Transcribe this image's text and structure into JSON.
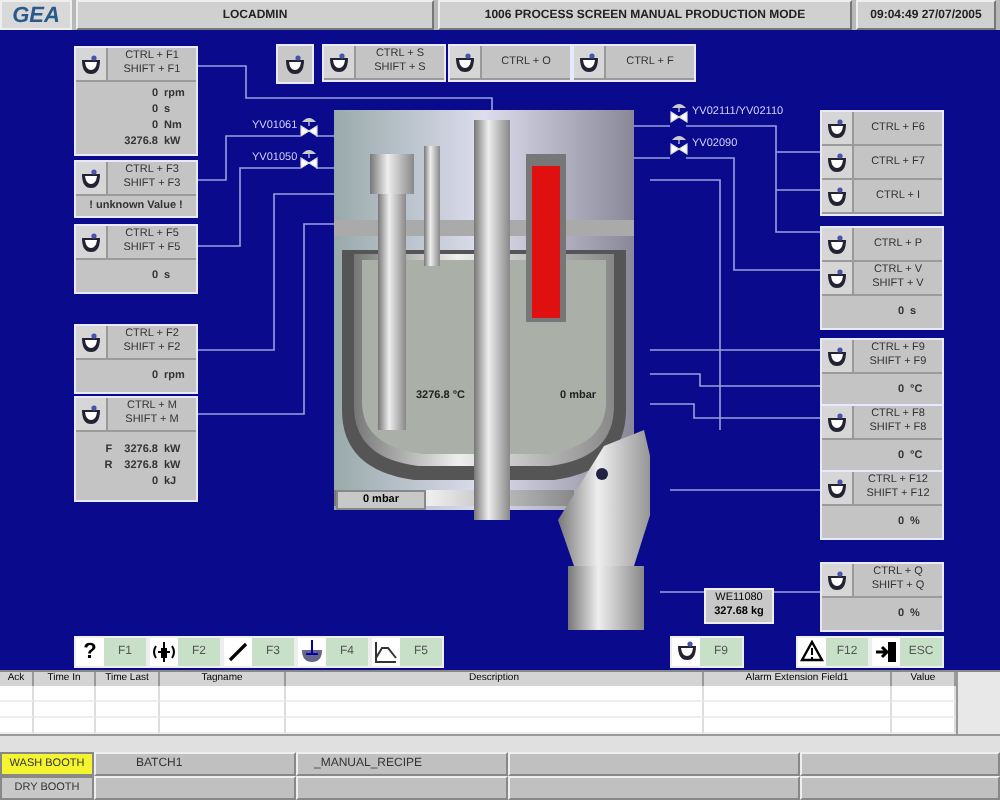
{
  "header": {
    "logo": "GEA",
    "user": "LOCADMIN",
    "title": "1006 PROCESS SCREEN MANUAL PRODUCTION  MODE",
    "datetime": "09:04:49  27/07/2005"
  },
  "left_panels": [
    {
      "keys": [
        "CTRL + F1",
        "SHIFT + F1"
      ],
      "readings": [
        {
          "value": "0",
          "unit": "rpm"
        },
        {
          "value": "0",
          "unit": "s"
        },
        {
          "value": "0",
          "unit": "Nm"
        },
        {
          "value": "3276.8",
          "unit": "kW"
        }
      ]
    },
    {
      "keys": [
        "CTRL + F3",
        "SHIFT + F3"
      ],
      "message": "! unknown Value !"
    },
    {
      "keys": [
        "CTRL + F5",
        "SHIFT + F5"
      ],
      "readings": [
        {
          "value": "0",
          "unit": "s"
        }
      ]
    },
    {
      "keys": [
        "CTRL + F2",
        "SHIFT + F2"
      ],
      "readings": [
        {
          "value": "0",
          "unit": "rpm"
        }
      ]
    },
    {
      "keys": [
        "CTRL + M",
        "SHIFT + M"
      ],
      "readings": [
        {
          "prefix": "F",
          "value": "3276.8",
          "unit": "kW"
        },
        {
          "prefix": "R",
          "value": "3276.8",
          "unit": "kW"
        },
        {
          "value": "0",
          "unit": "kJ"
        }
      ]
    }
  ],
  "top_panels": [
    {
      "keys": [
        "CTRL + S",
        "SHIFT + S"
      ]
    },
    {
      "keys": [
        "CTRL + O"
      ]
    },
    {
      "keys": [
        "CTRL + F"
      ]
    }
  ],
  "right_panels": [
    {
      "rows": [
        {
          "keys": [
            "CTRL + F6"
          ]
        },
        {
          "keys": [
            "CTRL + F7"
          ]
        },
        {
          "keys": [
            "CTRL + I"
          ]
        }
      ]
    },
    {
      "rows": [
        {
          "keys": [
            "CTRL + P"
          ]
        },
        {
          "keys": [
            "CTRL + V",
            "SHIFT + V"
          ]
        }
      ],
      "readings": [
        {
          "value": "0",
          "unit": "s"
        }
      ]
    },
    {
      "rows": [
        {
          "keys": [
            "CTRL + F9",
            "SHIFT + F9"
          ]
        }
      ],
      "readings": [
        {
          "value": "0",
          "unit": "°C"
        }
      ]
    },
    {
      "rows": [
        {
          "keys": [
            "CTRL + F8",
            "SHIFT + F8"
          ]
        }
      ],
      "readings": [
        {
          "value": "0",
          "unit": "°C"
        }
      ]
    },
    {
      "rows": [
        {
          "keys": [
            "CTRL + F12",
            "SHIFT + F12"
          ]
        }
      ],
      "readings": [
        {
          "value": "0",
          "unit": "%"
        }
      ]
    },
    {
      "rows": [
        {
          "keys": [
            "CTRL + Q",
            "SHIFT + Q"
          ]
        }
      ],
      "readings": [
        {
          "value": "0",
          "unit": "%"
        }
      ]
    }
  ],
  "valves": [
    {
      "tag": "YV01061"
    },
    {
      "tag": "YV01050"
    },
    {
      "tag": "YV02111/YV02110"
    },
    {
      "tag": "YV02090"
    }
  ],
  "vessel": {
    "temperature": "3276.8 °C",
    "pressure": "0  mbar",
    "pressure_box": "0  mbar"
  },
  "scale": {
    "tag": "WE11080",
    "value": "327.68 kg"
  },
  "function_keys": [
    {
      "kind": "help",
      "glyph": "?",
      "label": "F1"
    },
    {
      "kind": "agitator",
      "label": "F2"
    },
    {
      "kind": "pen",
      "label": "F3"
    },
    {
      "kind": "mixer",
      "label": "F4"
    },
    {
      "kind": "chart",
      "label": "F5"
    },
    {
      "kind": "bowl",
      "label": "F9"
    },
    {
      "kind": "warning",
      "label": "F12"
    },
    {
      "kind": "exit",
      "label": "ESC"
    }
  ],
  "alarm_table": {
    "columns": [
      "Ack",
      "Time In",
      "Time Last",
      "Tagname",
      "Description",
      "Alarm Extension Field1",
      "Value"
    ]
  },
  "status": {
    "booths": [
      {
        "label": "WASH BOOTH",
        "selected": true
      },
      {
        "label": "DRY BOOTH",
        "selected": false
      }
    ],
    "batch": "BATCH1",
    "recipe": "_MANUAL_RECIPE"
  }
}
